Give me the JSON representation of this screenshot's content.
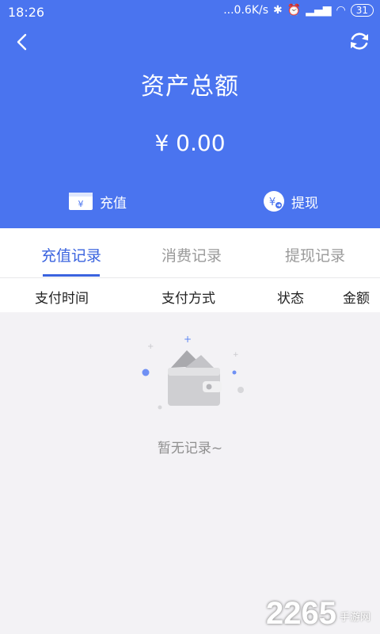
{
  "statusbar": {
    "time": "18:26",
    "network": "...0.6K/s",
    "battery": "31"
  },
  "header": {
    "title": "资产总额",
    "amount": "¥ 0.00"
  },
  "actions": {
    "recharge": {
      "label": "充值",
      "icon_glyph": "¥"
    },
    "withdraw": {
      "label": "提现",
      "icon_glyph": "¥"
    }
  },
  "tabs": [
    {
      "label": "充值记录",
      "active": true
    },
    {
      "label": "消费记录",
      "active": false
    },
    {
      "label": "提现记录",
      "active": false
    }
  ],
  "columns": [
    "支付时间",
    "支付方式",
    "状态",
    "金额"
  ],
  "empty_text": "暂无记录~",
  "watermark": {
    "number": "2265",
    "site": "手游网"
  },
  "colors": {
    "primary": "#4a74ef",
    "active_tab": "#3a63df",
    "background": "#f3f2f5"
  },
  "icons": [
    "back-arrow-icon",
    "refresh-icon",
    "card-icon",
    "coin-icon",
    "wallet-illustration"
  ]
}
